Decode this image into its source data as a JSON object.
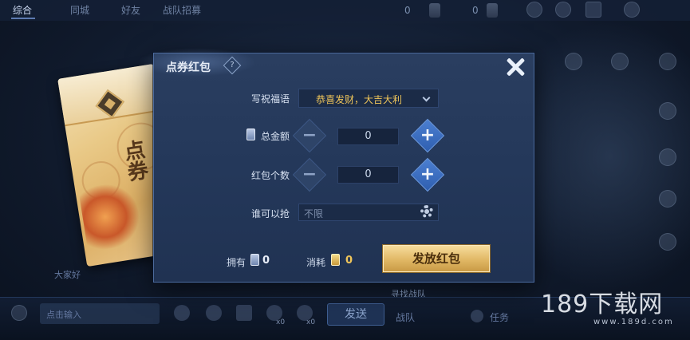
{
  "top_tabs": [
    "综合",
    "同城",
    "好友",
    "战队招募"
  ],
  "top_stats": [
    "0",
    "0"
  ],
  "dialog": {
    "title": "点券红包",
    "help_glyph": "?",
    "greeting_label": "写祝福语",
    "greeting_value": "恭喜发财，大吉大利",
    "total_label": "总金额",
    "total_value": "0",
    "count_label": "红包个数",
    "count_value": "0",
    "who_label": "谁可以抢",
    "who_value": "不限",
    "owned_label": "拥有",
    "owned_value": "0",
    "cost_label": "消耗",
    "cost_value": "0",
    "send_button": "发放红包"
  },
  "packet": {
    "title": "点券"
  },
  "chat": {
    "placeholder": "点击输入",
    "send_label": "发送",
    "left_label": "大家好",
    "x0_a": "x0",
    "x0_b": "x0",
    "bottom_mid": "战队",
    "bottom_right": "任务",
    "bottom_tag": "寻找战队"
  },
  "watermark": {
    "text": "189下载网",
    "sub": "www.189d.com"
  },
  "colors": {
    "accent_gold": "#f0c65a",
    "dialog_bg": "#24385a",
    "button_gold": "#e1b865"
  }
}
